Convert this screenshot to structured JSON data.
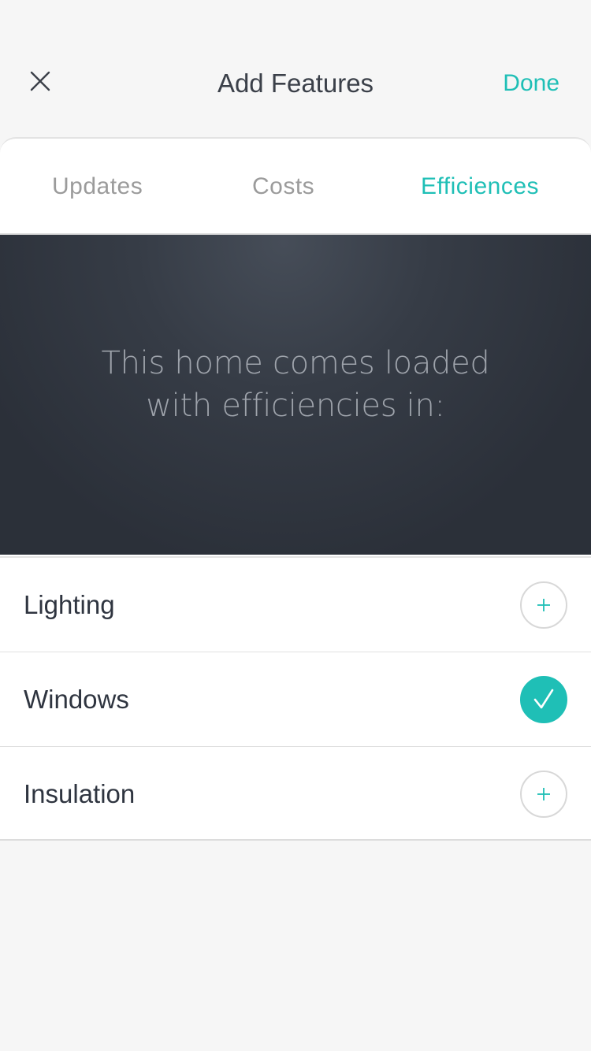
{
  "header": {
    "title": "Add Features",
    "close_icon": "close-icon",
    "done_label": "Done"
  },
  "tabs": [
    {
      "label": "Updates",
      "active": false
    },
    {
      "label": "Costs",
      "active": false
    },
    {
      "label": "Efficiences",
      "active": true
    }
  ],
  "hero": {
    "line1": "This home comes loaded",
    "line2": "with efficiencies in:"
  },
  "features": [
    {
      "label": "Lighting",
      "selected": false,
      "icon": "plus-icon"
    },
    {
      "label": "Windows",
      "selected": true,
      "icon": "check-icon"
    },
    {
      "label": "Insulation",
      "selected": false,
      "icon": "plus-icon"
    }
  ],
  "colors": {
    "accent": "#1fbfb6",
    "hero_dark": "#2b3039",
    "background": "#f6f6f6"
  }
}
